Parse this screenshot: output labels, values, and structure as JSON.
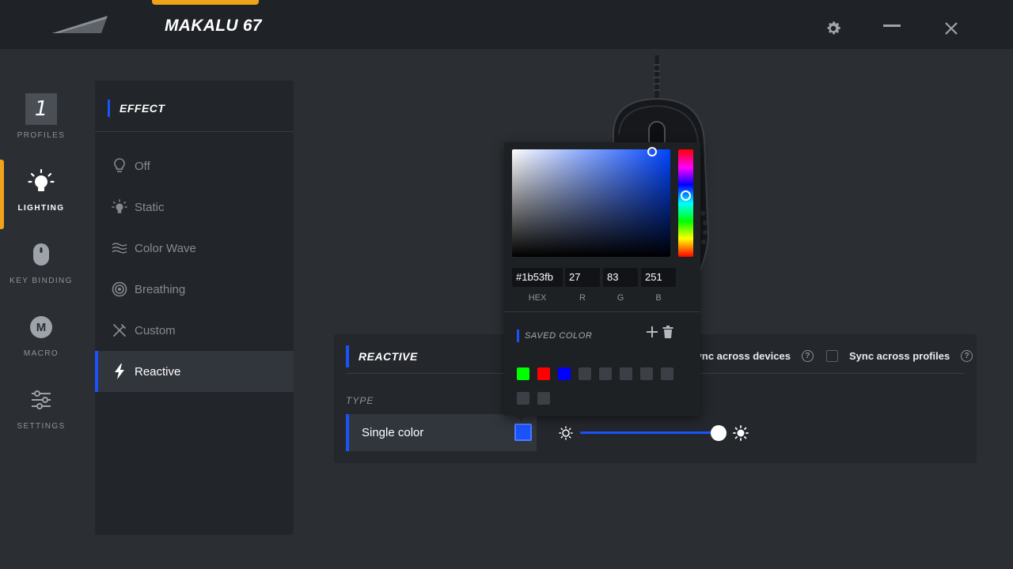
{
  "app": {
    "title": "MAKALU 67"
  },
  "colors": {
    "accent": "#1b53fb",
    "brand_tab": "#f0a21a"
  },
  "rail": [
    {
      "label": "PROFILES",
      "icon": "profile-number-icon",
      "value": "1"
    },
    {
      "label": "LIGHTING",
      "icon": "lightbulb-icon",
      "active": true
    },
    {
      "label": "KEY BINDING",
      "icon": "mouse-icon"
    },
    {
      "label": "MACRO",
      "icon": "macro-icon",
      "value": "M"
    },
    {
      "label": "SETTINGS",
      "icon": "sliders-icon"
    }
  ],
  "effect": {
    "title": "EFFECT",
    "items": [
      {
        "label": "Off",
        "icon": "bulb-off-icon"
      },
      {
        "label": "Static",
        "icon": "bulb-static-icon"
      },
      {
        "label": "Color Wave",
        "icon": "wave-icon"
      },
      {
        "label": "Breathing",
        "icon": "breathing-icon"
      },
      {
        "label": "Custom",
        "icon": "custom-brush-icon"
      },
      {
        "label": "Reactive",
        "icon": "lightning-icon",
        "active": true
      }
    ]
  },
  "reactive": {
    "title": "REACTIVE",
    "type_label": "TYPE",
    "type_value": "Single color",
    "sync_devices": "Sync across devices",
    "sync_profiles": "Sync across profiles",
    "help_glyph": "?",
    "brightness_percent": 100
  },
  "picker": {
    "hex": "#1b53fb",
    "r": "27",
    "g": "83",
    "b": "251",
    "hex_label": "HEX",
    "r_label": "R",
    "g_label": "G",
    "b_label": "B",
    "saved_title": "SAVED COLOR",
    "saved_colors": [
      "#00ff00",
      "#ff0000",
      "#0000ff",
      "#3c4046",
      "#3c4046",
      "#3c4046",
      "#3c4046",
      "#3c4046",
      "#3c4046",
      "#3c4046"
    ]
  }
}
